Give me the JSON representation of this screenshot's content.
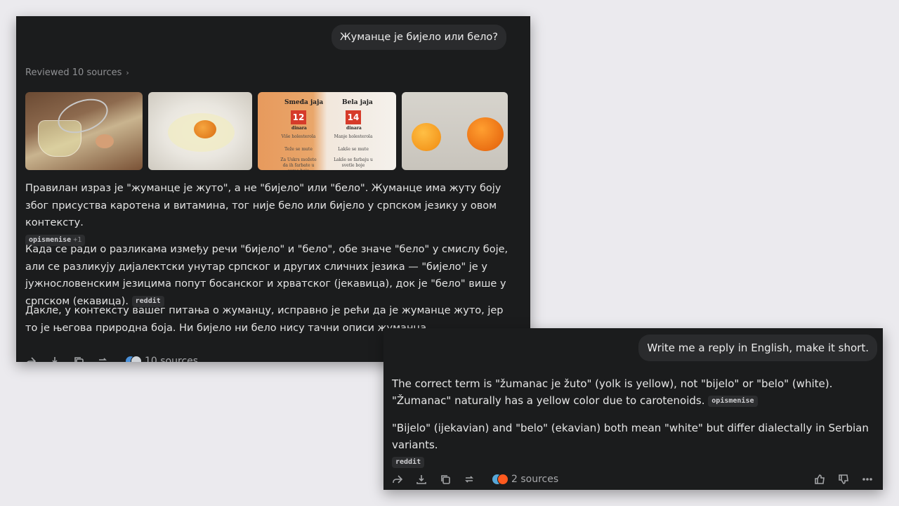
{
  "conversation1": {
    "user_message": "Жуманце је бијело или бело?",
    "reviewed_label": "Reviewed 10 sources",
    "image_tiles": {
      "tile3_left_heading": "Smeđa jaja",
      "tile3_left_price": "12",
      "tile3_left_currency": "dinara",
      "tile3_right_heading": "Bela jaja",
      "tile3_right_price": "14",
      "tile3_right_currency": "dinara",
      "tile3_left_lines": [
        "Više holesterola",
        "Teže se mute",
        "Za Uskrs možete da ih farbate u samo bojе"
      ],
      "tile3_right_lines": [
        "Manje holesterola",
        "Lakše se mute",
        "Lakše se farbaju u svetle boje"
      ]
    },
    "paragraphs": [
      {
        "text": "Правилан израз је \"жуманце је жуто\", а не \"бијело\" или \"бело\". Жуманце има жуту боју због присуства каротена и витамина, тог није бело или бијело у српском језику у овом контексту.",
        "chip": "opismenise",
        "chip_extra": "+1"
      },
      {
        "text": "Када се ради о разликама између речи \"бијело\" и \"бело\", обе значе \"бело\" у смислу боје, али се разликују дијалектски унутар српског и других сличних језика — \"бијело\" је у јужнословенским језицима попут босанског и хрватског (јекавица), док је \"бело\" више у српском (екавица).",
        "chip": "reddit"
      },
      {
        "text": "Дакле, у контексту вашег питања о жуманцу, исправно је рећи да је жуманце жуто, јер то је његова природна боја. Ни бијело ни бело нису тачни описи жуманца."
      }
    ],
    "sources_label": "10 sources"
  },
  "conversation2": {
    "user_message": "Write me a reply in English, make it short.",
    "paragraphs": [
      {
        "text": "The correct term is \"žumanac je žuto\" (yolk is yellow), not \"bijelo\" or \"belo\" (white). \"Žumanac\" naturally has a yellow color due to carotenoids.",
        "chip": "opismenise"
      },
      {
        "text": "\"Bijelo\" (ijekavian) and \"belo\" (ekavian) both mean \"white\" but differ dialectally in Serbian variants.",
        "chip": "reddit"
      }
    ],
    "sources_label": "2 sources"
  },
  "icons": {
    "share": "share-icon",
    "download": "download-icon",
    "copy": "copy-icon",
    "regenerate": "regenerate-icon",
    "like": "thumbs-up-icon",
    "dislike": "thumbs-down-icon",
    "more": "more-icon"
  },
  "colors": {
    "page_bg": "#ebeaee",
    "panel_bg": "#1b1c1d",
    "bubble_bg": "#2a2b2d",
    "chip_bg": "#2c2d2f",
    "muted_text": "#8f9093"
  }
}
